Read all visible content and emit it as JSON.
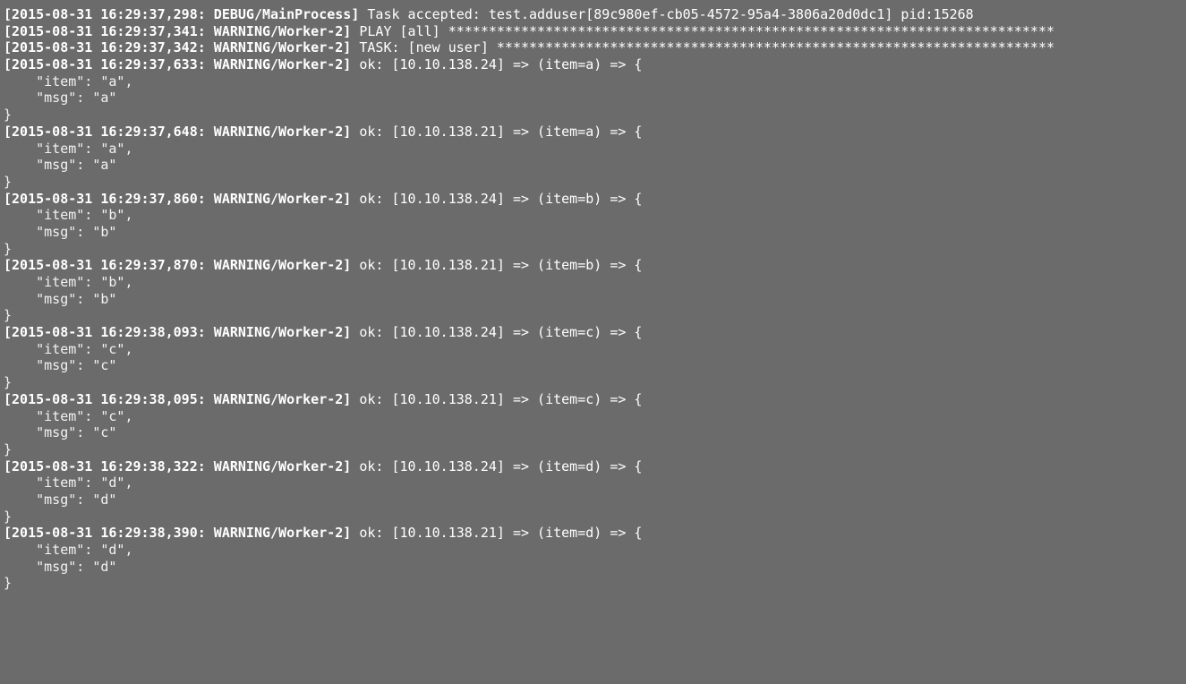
{
  "terminal": {
    "lines": [
      {
        "ts": "[2015-08-31 16:29:37,298:",
        "sev": " DEBUG/MainProcess]",
        "rest": " Task accepted: test.adduser[89c980ef-cb05-4572-95a4-3806a20d0dc1] pid:15268"
      },
      {
        "ts": "[2015-08-31 16:29:37,341:",
        "sev": " WARNING/Worker-2]",
        "rest": " PLAY [all] ***************************************************************************"
      },
      {
        "ts": "[2015-08-31 16:29:37,342:",
        "sev": " WARNING/Worker-2]",
        "rest": " TASK: [new user] *********************************************************************"
      },
      {
        "ts": "[2015-08-31 16:29:37,633:",
        "sev": " WARNING/Worker-2]",
        "rest": " ok: [10.10.138.24] => (item=a) => {"
      },
      {
        "text": "    \"item\": \"a\","
      },
      {
        "text": "    \"msg\": \"a\""
      },
      {
        "text": "}"
      },
      {
        "ts": "[2015-08-31 16:29:37,648:",
        "sev": " WARNING/Worker-2]",
        "rest": " ok: [10.10.138.21] => (item=a) => {"
      },
      {
        "text": "    \"item\": \"a\","
      },
      {
        "text": "    \"msg\": \"a\""
      },
      {
        "text": "}"
      },
      {
        "ts": "[2015-08-31 16:29:37,860:",
        "sev": " WARNING/Worker-2]",
        "rest": " ok: [10.10.138.24] => (item=b) => {"
      },
      {
        "text": "    \"item\": \"b\","
      },
      {
        "text": "    \"msg\": \"b\""
      },
      {
        "text": "}"
      },
      {
        "ts": "[2015-08-31 16:29:37,870:",
        "sev": " WARNING/Worker-2]",
        "rest": " ok: [10.10.138.21] => (item=b) => {"
      },
      {
        "text": "    \"item\": \"b\","
      },
      {
        "text": "    \"msg\": \"b\""
      },
      {
        "text": "}"
      },
      {
        "ts": "[2015-08-31 16:29:38,093:",
        "sev": " WARNING/Worker-2]",
        "rest": " ok: [10.10.138.24] => (item=c) => {"
      },
      {
        "text": "    \"item\": \"c\","
      },
      {
        "text": "    \"msg\": \"c\""
      },
      {
        "text": "}"
      },
      {
        "ts": "[2015-08-31 16:29:38,095:",
        "sev": " WARNING/Worker-2]",
        "rest": " ok: [10.10.138.21] => (item=c) => {"
      },
      {
        "text": "    \"item\": \"c\","
      },
      {
        "text": "    \"msg\": \"c\""
      },
      {
        "text": "}"
      },
      {
        "ts": "[2015-08-31 16:29:38,322:",
        "sev": " WARNING/Worker-2]",
        "rest": " ok: [10.10.138.24] => (item=d) => {"
      },
      {
        "text": "    \"item\": \"d\","
      },
      {
        "text": "    \"msg\": \"d\""
      },
      {
        "text": "}"
      },
      {
        "ts": "[2015-08-31 16:29:38,390:",
        "sev": " WARNING/Worker-2]",
        "rest": " ok: [10.10.138.21] => (item=d) => {"
      },
      {
        "text": "    \"item\": \"d\","
      },
      {
        "text": "    \"msg\": \"d\""
      },
      {
        "text": "}"
      }
    ]
  },
  "colors": {
    "background": "#6b6b6b",
    "text": "#ffffff"
  }
}
